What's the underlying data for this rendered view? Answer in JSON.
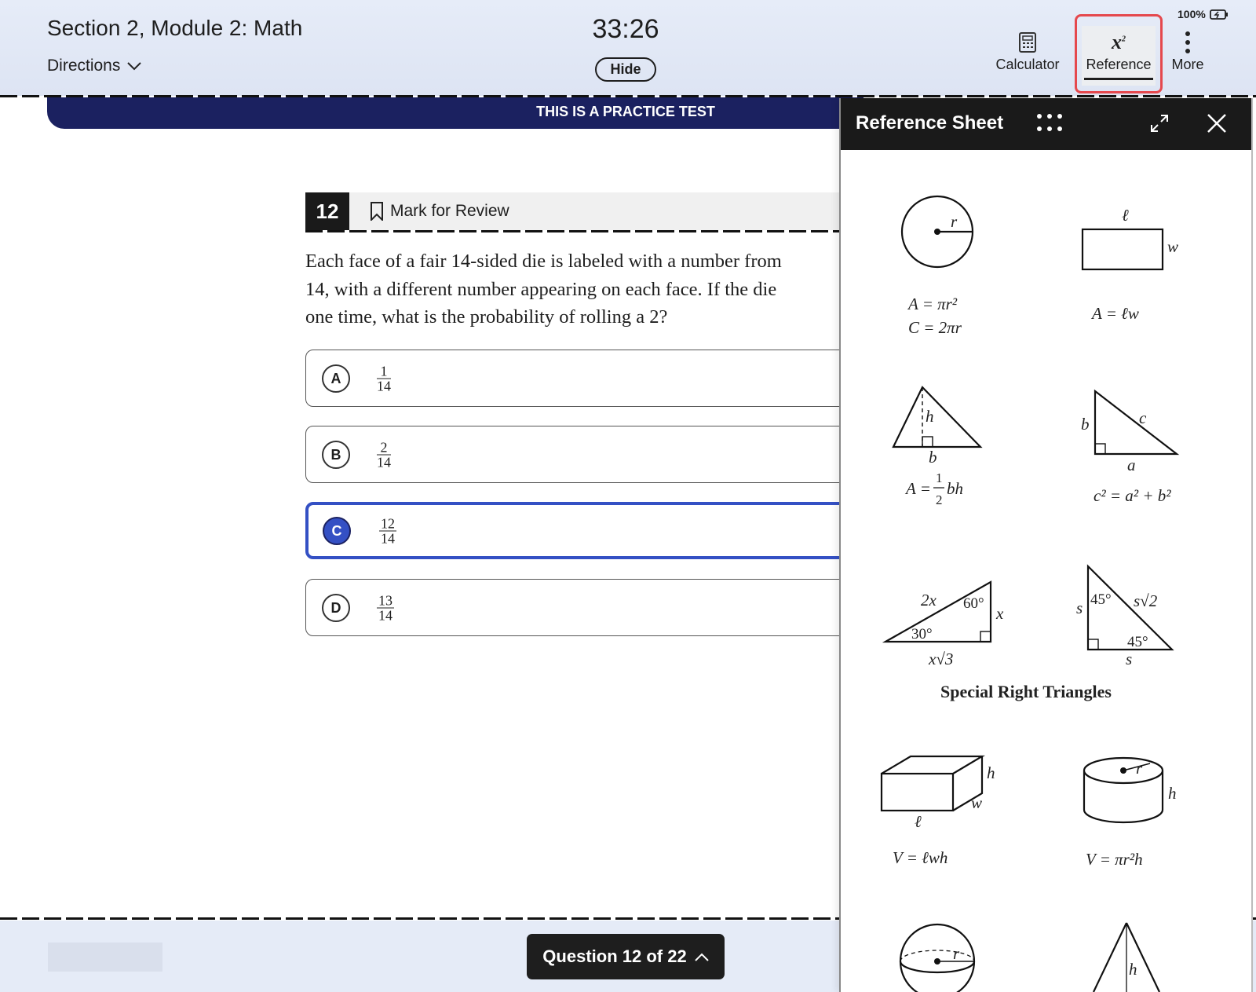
{
  "header": {
    "title": "Section 2, Module 2: Math",
    "directions_label": "Directions",
    "timer": "33:26",
    "hide_label": "Hide",
    "tools": [
      {
        "label": "Calculator",
        "icon": "calculator-icon"
      },
      {
        "label": "Reference",
        "icon": "x-squared-icon",
        "active": true
      },
      {
        "label": "More",
        "icon": "more-vertical-icon"
      }
    ],
    "battery": "100%"
  },
  "banner": "THIS IS A PRACTICE TEST",
  "question": {
    "number": "12",
    "mark_label": "Mark for Review",
    "text": [
      "Each face of a fair 14-sided die is labeled with a number from",
      "14, with a different number appearing on each face. If the die",
      "one time, what is the probability of rolling a 2?"
    ],
    "options": [
      {
        "letter": "A",
        "num": "1",
        "den": "14"
      },
      {
        "letter": "B",
        "num": "2",
        "den": "14"
      },
      {
        "letter": "C",
        "num": "12",
        "den": "14",
        "selected": true
      },
      {
        "letter": "D",
        "num": "13",
        "den": "14"
      }
    ]
  },
  "footer": {
    "nav_label": "Question 12 of 22"
  },
  "reference": {
    "title": "Reference Sheet",
    "circle": {
      "r": "r",
      "area": "A = πr²",
      "circ": "C = 2πr"
    },
    "rect": {
      "l": "ℓ",
      "w": "w",
      "area": "A = ℓw"
    },
    "triangle": {
      "h": "h",
      "b": "b",
      "area_a": "A =",
      "area_num": "1",
      "area_den": "2",
      "area_b": "bh"
    },
    "right": {
      "a": "a",
      "b": "b",
      "c": "c",
      "formula": "c² = a² + b²"
    },
    "t3060": {
      "hyp": "2x",
      "a60": "60°",
      "short": "x",
      "a30": "30°",
      "long": "x√3"
    },
    "t45": {
      "s1": "s",
      "a1": "45°",
      "hyp": "s√2",
      "a2": "45°",
      "s2": "s"
    },
    "special_title": "Special Right Triangles",
    "box": {
      "h": "h",
      "w": "w",
      "l": "ℓ",
      "volume": "V = ℓwh"
    },
    "cyl": {
      "r": "r",
      "h": "h",
      "volume": "V = πr²h"
    },
    "sphere": {
      "r": "r"
    },
    "cone": {
      "h": "h"
    }
  },
  "colors": {
    "accent": "#3450c4",
    "banner": "#1b2160",
    "highlight": "#e5484d"
  }
}
